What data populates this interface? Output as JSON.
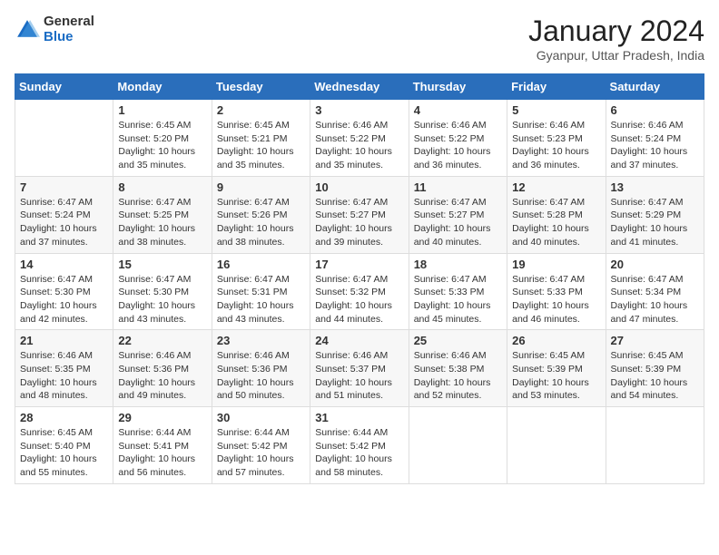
{
  "logo": {
    "general": "General",
    "blue": "Blue"
  },
  "title": "January 2024",
  "location": "Gyanpur, Uttar Pradesh, India",
  "weekdays": [
    "Sunday",
    "Monday",
    "Tuesday",
    "Wednesday",
    "Thursday",
    "Friday",
    "Saturday"
  ],
  "weeks": [
    [
      {
        "day": "",
        "sunrise": "",
        "sunset": "",
        "daylight": ""
      },
      {
        "day": "1",
        "sunrise": "Sunrise: 6:45 AM",
        "sunset": "Sunset: 5:20 PM",
        "daylight": "Daylight: 10 hours and 35 minutes."
      },
      {
        "day": "2",
        "sunrise": "Sunrise: 6:45 AM",
        "sunset": "Sunset: 5:21 PM",
        "daylight": "Daylight: 10 hours and 35 minutes."
      },
      {
        "day": "3",
        "sunrise": "Sunrise: 6:46 AM",
        "sunset": "Sunset: 5:22 PM",
        "daylight": "Daylight: 10 hours and 35 minutes."
      },
      {
        "day": "4",
        "sunrise": "Sunrise: 6:46 AM",
        "sunset": "Sunset: 5:22 PM",
        "daylight": "Daylight: 10 hours and 36 minutes."
      },
      {
        "day": "5",
        "sunrise": "Sunrise: 6:46 AM",
        "sunset": "Sunset: 5:23 PM",
        "daylight": "Daylight: 10 hours and 36 minutes."
      },
      {
        "day": "6",
        "sunrise": "Sunrise: 6:46 AM",
        "sunset": "Sunset: 5:24 PM",
        "daylight": "Daylight: 10 hours and 37 minutes."
      }
    ],
    [
      {
        "day": "7",
        "sunrise": "Sunrise: 6:47 AM",
        "sunset": "Sunset: 5:24 PM",
        "daylight": "Daylight: 10 hours and 37 minutes."
      },
      {
        "day": "8",
        "sunrise": "Sunrise: 6:47 AM",
        "sunset": "Sunset: 5:25 PM",
        "daylight": "Daylight: 10 hours and 38 minutes."
      },
      {
        "day": "9",
        "sunrise": "Sunrise: 6:47 AM",
        "sunset": "Sunset: 5:26 PM",
        "daylight": "Daylight: 10 hours and 38 minutes."
      },
      {
        "day": "10",
        "sunrise": "Sunrise: 6:47 AM",
        "sunset": "Sunset: 5:27 PM",
        "daylight": "Daylight: 10 hours and 39 minutes."
      },
      {
        "day": "11",
        "sunrise": "Sunrise: 6:47 AM",
        "sunset": "Sunset: 5:27 PM",
        "daylight": "Daylight: 10 hours and 40 minutes."
      },
      {
        "day": "12",
        "sunrise": "Sunrise: 6:47 AM",
        "sunset": "Sunset: 5:28 PM",
        "daylight": "Daylight: 10 hours and 40 minutes."
      },
      {
        "day": "13",
        "sunrise": "Sunrise: 6:47 AM",
        "sunset": "Sunset: 5:29 PM",
        "daylight": "Daylight: 10 hours and 41 minutes."
      }
    ],
    [
      {
        "day": "14",
        "sunrise": "Sunrise: 6:47 AM",
        "sunset": "Sunset: 5:30 PM",
        "daylight": "Daylight: 10 hours and 42 minutes."
      },
      {
        "day": "15",
        "sunrise": "Sunrise: 6:47 AM",
        "sunset": "Sunset: 5:30 PM",
        "daylight": "Daylight: 10 hours and 43 minutes."
      },
      {
        "day": "16",
        "sunrise": "Sunrise: 6:47 AM",
        "sunset": "Sunset: 5:31 PM",
        "daylight": "Daylight: 10 hours and 43 minutes."
      },
      {
        "day": "17",
        "sunrise": "Sunrise: 6:47 AM",
        "sunset": "Sunset: 5:32 PM",
        "daylight": "Daylight: 10 hours and 44 minutes."
      },
      {
        "day": "18",
        "sunrise": "Sunrise: 6:47 AM",
        "sunset": "Sunset: 5:33 PM",
        "daylight": "Daylight: 10 hours and 45 minutes."
      },
      {
        "day": "19",
        "sunrise": "Sunrise: 6:47 AM",
        "sunset": "Sunset: 5:33 PM",
        "daylight": "Daylight: 10 hours and 46 minutes."
      },
      {
        "day": "20",
        "sunrise": "Sunrise: 6:47 AM",
        "sunset": "Sunset: 5:34 PM",
        "daylight": "Daylight: 10 hours and 47 minutes."
      }
    ],
    [
      {
        "day": "21",
        "sunrise": "Sunrise: 6:46 AM",
        "sunset": "Sunset: 5:35 PM",
        "daylight": "Daylight: 10 hours and 48 minutes."
      },
      {
        "day": "22",
        "sunrise": "Sunrise: 6:46 AM",
        "sunset": "Sunset: 5:36 PM",
        "daylight": "Daylight: 10 hours and 49 minutes."
      },
      {
        "day": "23",
        "sunrise": "Sunrise: 6:46 AM",
        "sunset": "Sunset: 5:36 PM",
        "daylight": "Daylight: 10 hours and 50 minutes."
      },
      {
        "day": "24",
        "sunrise": "Sunrise: 6:46 AM",
        "sunset": "Sunset: 5:37 PM",
        "daylight": "Daylight: 10 hours and 51 minutes."
      },
      {
        "day": "25",
        "sunrise": "Sunrise: 6:46 AM",
        "sunset": "Sunset: 5:38 PM",
        "daylight": "Daylight: 10 hours and 52 minutes."
      },
      {
        "day": "26",
        "sunrise": "Sunrise: 6:45 AM",
        "sunset": "Sunset: 5:39 PM",
        "daylight": "Daylight: 10 hours and 53 minutes."
      },
      {
        "day": "27",
        "sunrise": "Sunrise: 6:45 AM",
        "sunset": "Sunset: 5:39 PM",
        "daylight": "Daylight: 10 hours and 54 minutes."
      }
    ],
    [
      {
        "day": "28",
        "sunrise": "Sunrise: 6:45 AM",
        "sunset": "Sunset: 5:40 PM",
        "daylight": "Daylight: 10 hours and 55 minutes."
      },
      {
        "day": "29",
        "sunrise": "Sunrise: 6:44 AM",
        "sunset": "Sunset: 5:41 PM",
        "daylight": "Daylight: 10 hours and 56 minutes."
      },
      {
        "day": "30",
        "sunrise": "Sunrise: 6:44 AM",
        "sunset": "Sunset: 5:42 PM",
        "daylight": "Daylight: 10 hours and 57 minutes."
      },
      {
        "day": "31",
        "sunrise": "Sunrise: 6:44 AM",
        "sunset": "Sunset: 5:42 PM",
        "daylight": "Daylight: 10 hours and 58 minutes."
      },
      {
        "day": "",
        "sunrise": "",
        "sunset": "",
        "daylight": ""
      },
      {
        "day": "",
        "sunrise": "",
        "sunset": "",
        "daylight": ""
      },
      {
        "day": "",
        "sunrise": "",
        "sunset": "",
        "daylight": ""
      }
    ]
  ]
}
